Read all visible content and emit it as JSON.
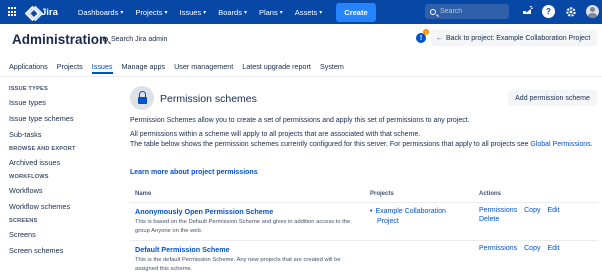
{
  "topbar": {
    "logo_text": "Jira",
    "nav": [
      {
        "label": "Dashboards"
      },
      {
        "label": "Projects"
      },
      {
        "label": "Issues"
      },
      {
        "label": "Boards"
      },
      {
        "label": "Plans"
      },
      {
        "label": "Assets"
      }
    ],
    "create_label": "Create",
    "search_placeholder": "Search",
    "icons": [
      "app-switcher-icon",
      "notifications-icon",
      "help-icon",
      "settings-icon",
      "avatar"
    ],
    "bg_color": "#0747a6",
    "create_color": "#2684ff"
  },
  "header": {
    "title": "Administration",
    "search_label": "Search Jira admin",
    "notification_count": "1",
    "back_button_label": "Back to project: Example Collaboration Project"
  },
  "tabs": [
    {
      "label": "Applications",
      "active": false
    },
    {
      "label": "Projects",
      "active": false
    },
    {
      "label": "Issues",
      "active": true
    },
    {
      "label": "Manage apps",
      "active": false
    },
    {
      "label": "User management",
      "active": false
    },
    {
      "label": "Latest upgrade report",
      "active": false
    },
    {
      "label": "System",
      "active": false
    }
  ],
  "sidebar": {
    "groups": [
      {
        "heading": "ISSUE TYPES",
        "items": [
          "Issue types",
          "Issue type schemes",
          "Sub-tasks"
        ]
      },
      {
        "heading": "BROWSE AND EXPORT",
        "items": [
          "Archived issues"
        ]
      },
      {
        "heading": "WORKFLOWS",
        "items": [
          "Workflows",
          "Workflow schemes"
        ]
      },
      {
        "heading": "SCREENS",
        "items": [
          "Screens",
          "Screen schemes"
        ]
      }
    ]
  },
  "main": {
    "title": "Permission schemes",
    "add_button_label": "Add permission scheme",
    "desc1": "Permission Schemes allow you to create a set of permissions and apply this set of permissions to any project.",
    "desc2": "All permissions within a scheme will apply to all projects that are associated with that scheme.",
    "desc3": "The table below shows the permission schemes currently configured for this server. For permissions that apply to all projects see ",
    "desc3_link": "Global Permissions",
    "desc3_end": ".",
    "learn_more": "Learn more about project permissions",
    "table": {
      "headers": {
        "name": "Name",
        "projects": "Projects",
        "actions": "Actions"
      },
      "rows": [
        {
          "name": "Anonymously Open Permission Scheme",
          "description": "This is based on the Default Permission Scheme and gives in addition access to the group Anyone on the web.",
          "project_line1": "Example Collaboration",
          "project_line2": "Project",
          "actions": [
            "Permissions",
            "Copy",
            "Edit",
            "Delete"
          ]
        },
        {
          "name": "Default Permission Scheme",
          "description": "This is the default Permission Scheme. Any new projects that are created will be assigned this scheme.",
          "actions": [
            "Permissions",
            "Copy",
            "Edit"
          ]
        }
      ]
    }
  }
}
